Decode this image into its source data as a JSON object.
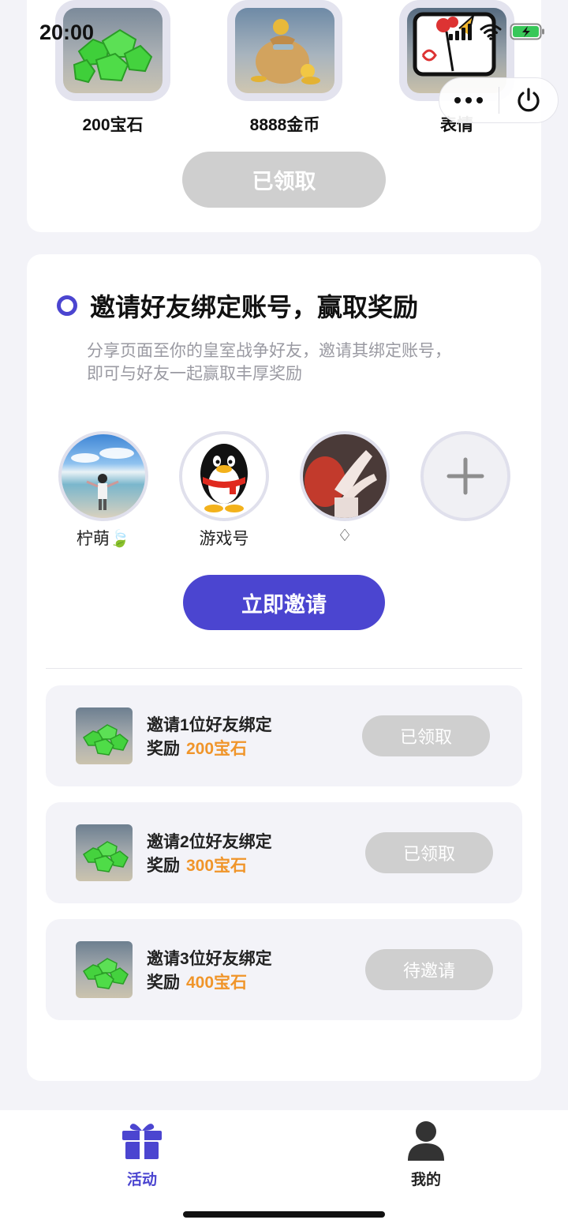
{
  "status": {
    "time": "20:00"
  },
  "top_rewards": {
    "items": [
      {
        "label": "200宝石",
        "icon": "gem-icon"
      },
      {
        "label": "8888金币",
        "icon": "coin-bag-icon"
      },
      {
        "label": "表情",
        "icon": "sticker-icon"
      }
    ],
    "claim_label": "已领取"
  },
  "invite": {
    "title": "邀请好友绑定账号，赢取奖励",
    "desc_line1": "分享页面至你的皇室战争好友，邀请其绑定账号，",
    "desc_line2": "即可与好友一起赢取丰厚奖励",
    "friends": [
      {
        "name": "柠萌🍃"
      },
      {
        "name": "游戏号"
      },
      {
        "name": "♢"
      }
    ],
    "add_icon": "plus-icon",
    "invite_button": "立即邀请"
  },
  "tasks": [
    {
      "line1": "邀请1位好友绑定",
      "reward_prefix": "奖励",
      "reward": "200宝石",
      "button": "已领取"
    },
    {
      "line1": "邀请2位好友绑定",
      "reward_prefix": "奖励",
      "reward": "300宝石",
      "button": "已领取"
    },
    {
      "line1": "邀请3位好友绑定",
      "reward_prefix": "奖励",
      "reward": "400宝石",
      "button": "待邀请"
    }
  ],
  "tabs": [
    {
      "label": "活动",
      "icon": "gift-icon",
      "active": true
    },
    {
      "label": "我的",
      "icon": "user-icon",
      "active": false
    }
  ],
  "colors": {
    "accent": "#4b45d0",
    "reward_orange": "#f0952a",
    "disabled_button": "#cfcfcf",
    "page_bg": "#f3f3f8"
  }
}
